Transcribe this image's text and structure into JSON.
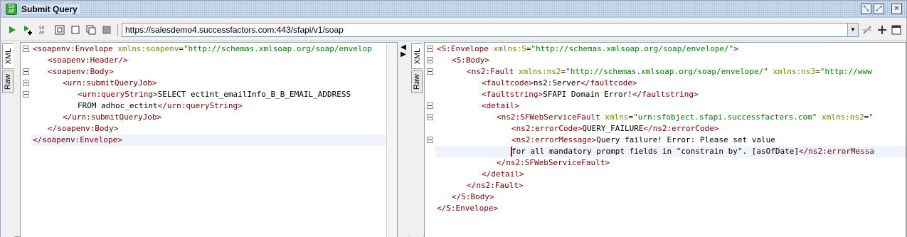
{
  "window": {
    "title": "Submit Query",
    "app_icon_text": "SO\nAP"
  },
  "toolbar": {
    "url": "https://salesdemo4.successfactors.com:443/sfapi/v1/soap",
    "icons": [
      "run-icon",
      "add-step-icon",
      "wsdl-icon",
      "request-settings-icon",
      "stop-icon",
      "clone-icon",
      "cancel-icon",
      "url-dropdown-icon",
      "endpoint-settings-icon",
      "add-endpoint-icon",
      "maximize-icon"
    ]
  },
  "tabs": {
    "left": {
      "xml": "XML",
      "raw": "Raw"
    },
    "right": {
      "xml": "XML",
      "raw": "Raw"
    }
  },
  "request": {
    "lines": [
      {
        "fold": true,
        "indent": 0,
        "parts": [
          [
            "t",
            "<soapenv:Envelope "
          ],
          [
            "a",
            "xmlns:soapenv"
          ],
          [
            "x",
            "="
          ],
          [
            "v",
            "\"http://schemas.xmlsoap.org/soap/envelop"
          ]
        ]
      },
      {
        "fold": false,
        "indent": 1,
        "parts": [
          [
            "t",
            "<soapenv:Header/>"
          ]
        ]
      },
      {
        "fold": true,
        "indent": 1,
        "parts": [
          [
            "t",
            "<soapenv:Body>"
          ]
        ]
      },
      {
        "fold": true,
        "indent": 2,
        "parts": [
          [
            "t",
            "<urn:submitQueryJob>"
          ]
        ]
      },
      {
        "fold": true,
        "indent": 3,
        "parts": [
          [
            "t",
            "<urn:queryString>"
          ],
          [
            "x",
            "SELECT ectint_emailInfo_B_B_EMAIL_ADDRESS"
          ]
        ]
      },
      {
        "fold": false,
        "indent": 3,
        "parts": [
          [
            "x",
            "FROM adhoc_ectint"
          ],
          [
            "t",
            "</urn:queryString>"
          ]
        ]
      },
      {
        "fold": false,
        "indent": 2,
        "parts": [
          [
            "t",
            "</urn:submitQueryJob>"
          ]
        ]
      },
      {
        "fold": false,
        "indent": 1,
        "parts": [
          [
            "t",
            "</soapenv:Body>"
          ]
        ]
      },
      {
        "fold": false,
        "indent": 0,
        "parts": [
          [
            "t",
            "</soapenv:Envelope>"
          ]
        ],
        "highlight": true
      }
    ]
  },
  "response": {
    "lines": [
      {
        "fold": true,
        "indent": 0,
        "parts": [
          [
            "t",
            "<S:Envelope "
          ],
          [
            "a",
            "xmlns:S"
          ],
          [
            "x",
            "="
          ],
          [
            "v",
            "\"http://schemas.xmlsoap.org/soap/envelope/\""
          ],
          [
            "t",
            ">"
          ]
        ]
      },
      {
        "fold": true,
        "indent": 1,
        "parts": [
          [
            "t",
            "<S:Body>"
          ]
        ]
      },
      {
        "fold": true,
        "indent": 2,
        "parts": [
          [
            "t",
            "<ns2:Fault "
          ],
          [
            "a",
            "xmlns:ns2"
          ],
          [
            "x",
            "="
          ],
          [
            "v",
            "\"http://schemas.xmlsoap.org/soap/envelope/\""
          ],
          [
            "x",
            " "
          ],
          [
            "a",
            "xmlns:ns3"
          ],
          [
            "x",
            "="
          ],
          [
            "v",
            "\"http://www"
          ]
        ]
      },
      {
        "fold": false,
        "indent": 3,
        "parts": [
          [
            "t",
            "<faultcode>"
          ],
          [
            "x",
            "ns2:Server"
          ],
          [
            "t",
            "</faultcode>"
          ]
        ]
      },
      {
        "fold": false,
        "indent": 3,
        "parts": [
          [
            "t",
            "<faultstring>"
          ],
          [
            "x",
            "SFAPI Domain Error!"
          ],
          [
            "t",
            "</faultstring>"
          ]
        ]
      },
      {
        "fold": true,
        "indent": 3,
        "parts": [
          [
            "t",
            "<detail>"
          ]
        ]
      },
      {
        "fold": true,
        "indent": 4,
        "parts": [
          [
            "t",
            "<ns2:SFWebServiceFault "
          ],
          [
            "a",
            "xmlns"
          ],
          [
            "x",
            "="
          ],
          [
            "v",
            "\"urn:sfobject.sfapi.successfactors.com\""
          ],
          [
            "x",
            " "
          ],
          [
            "a",
            "xmlns:ns2"
          ],
          [
            "x",
            "="
          ],
          [
            "v",
            "\""
          ]
        ]
      },
      {
        "fold": false,
        "indent": 5,
        "parts": [
          [
            "t",
            "<ns2:errorCode>"
          ],
          [
            "x",
            "QUERY_FAILURE"
          ],
          [
            "t",
            "</ns2:errorCode>"
          ]
        ]
      },
      {
        "fold": true,
        "indent": 5,
        "parts": [
          [
            "t",
            "<ns2:errorMessage>"
          ],
          [
            "x",
            "Query failure! Error: Please set value"
          ]
        ]
      },
      {
        "fold": false,
        "indent": 5,
        "parts": [
          [
            "x",
            "for all mandatory prompt fields in \"constrain by\". [asOfDate]"
          ],
          [
            "t",
            "</ns2:errorMessa"
          ]
        ],
        "highlight": true,
        "caret": true
      },
      {
        "fold": false,
        "indent": 4,
        "parts": [
          [
            "t",
            "</ns2:SFWebServiceFault>"
          ]
        ]
      },
      {
        "fold": false,
        "indent": 3,
        "parts": [
          [
            "t",
            "</detail>"
          ]
        ]
      },
      {
        "fold": false,
        "indent": 2,
        "parts": [
          [
            "t",
            "</ns2:Fault>"
          ]
        ]
      },
      {
        "fold": false,
        "indent": 1,
        "parts": [
          [
            "t",
            "</S:Body>"
          ]
        ]
      },
      {
        "fold": false,
        "indent": 0,
        "parts": [
          [
            "t",
            "</S:Envelope>"
          ]
        ]
      }
    ]
  },
  "colors": {
    "tag": "#800000",
    "attribute": "#808000",
    "value": "#008000",
    "text": "#000000",
    "current_line": "#f0f3fb"
  }
}
